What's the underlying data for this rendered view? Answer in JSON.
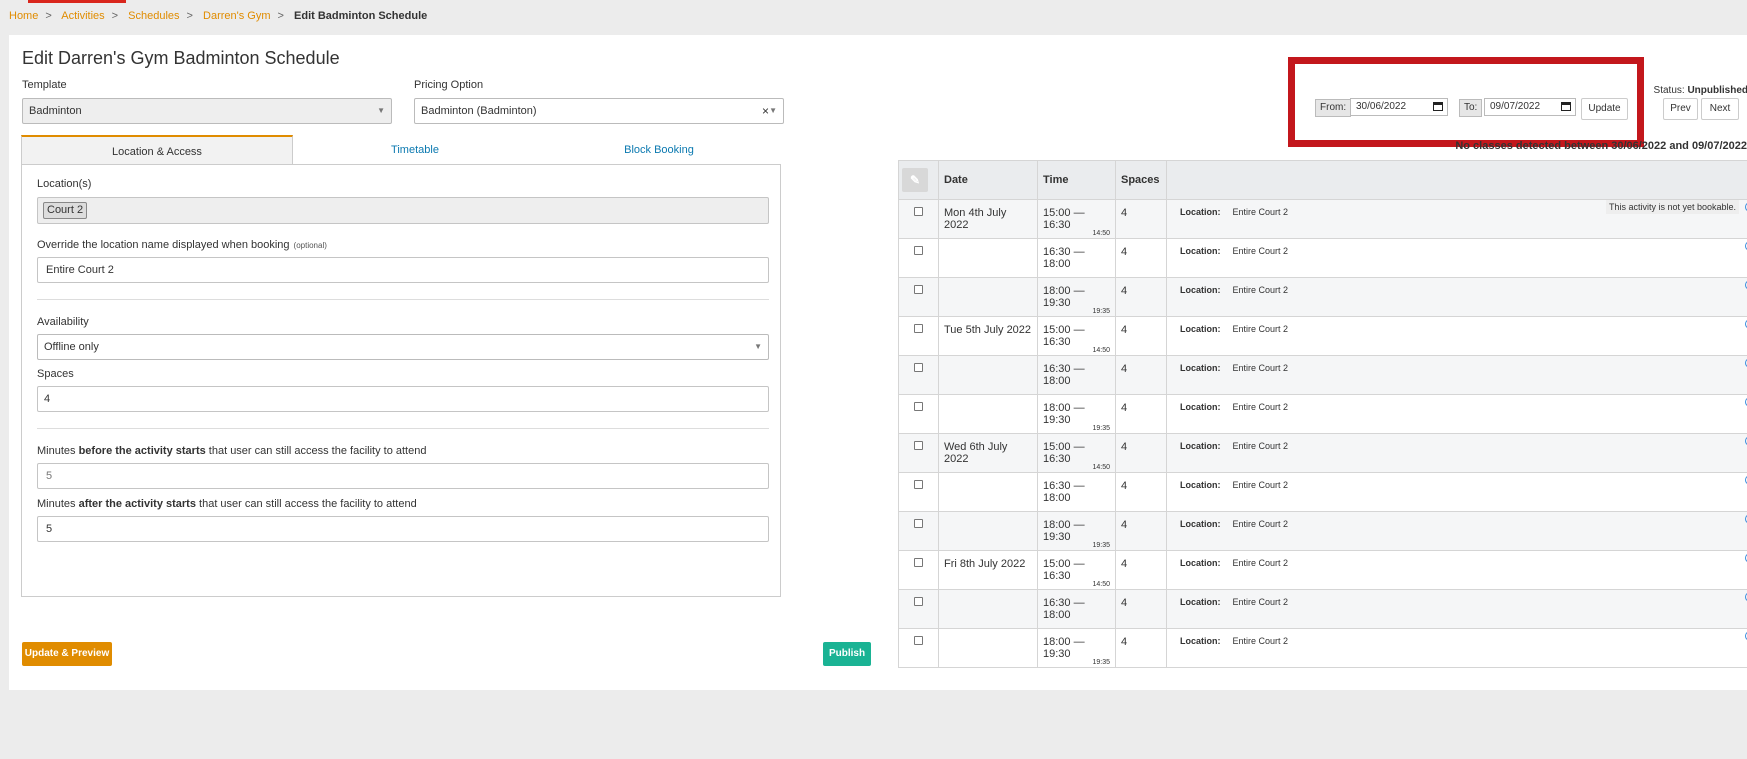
{
  "breadcrumb": [
    "Home",
    "Activities",
    "Schedules",
    "Darren's Gym"
  ],
  "breadcrumb_current": "Edit Badminton Schedule",
  "page_title": "Edit Darren's Gym Badminton Schedule",
  "template": {
    "label": "Template",
    "value": "Badminton"
  },
  "pricing": {
    "label": "Pricing Option",
    "value": "Badminton (Badminton)",
    "clear": "×"
  },
  "tabs": [
    "Location & Access",
    "Timetable",
    "Block Booking"
  ],
  "form": {
    "locations_label": "Location(s)",
    "location_chip": "Court 2",
    "override_label": "Override the location name displayed when booking",
    "override_optional": "(optional)",
    "override_value": "Entire Court 2",
    "availability_label": "Availability",
    "availability_value": "Offline only",
    "spaces_label": "Spaces",
    "spaces_value": "4",
    "before_pre": "Minutes ",
    "before_bold": "before the activity starts",
    "before_post": " that user can still access the facility to attend",
    "before_value": "5",
    "after_pre": "Minutes ",
    "after_bold": "after the activity starts",
    "after_post": " that user can still access the facility to attend",
    "after_value": "5"
  },
  "buttons": {
    "update_preview": "Update & Preview",
    "publish": "Publish",
    "update": "Update",
    "prev": "Prev",
    "next": "Next"
  },
  "colors": {
    "accent_orange": "#e08c00",
    "publish_green": "#1ab394",
    "highlight_red": "#c3171c"
  },
  "dates": {
    "from_label": "From:",
    "from_value": "30/06/2022",
    "to_label": "To:",
    "to_value": "09/07/2022"
  },
  "status_label": "Status: ",
  "status_value": "Unpublished",
  "notice": "No classes detected between 30/06/2022 and 09/07/2022",
  "table": {
    "headers": [
      "Date",
      "Time",
      "Spaces"
    ],
    "location_label": "Location:",
    "not_bookable": "This activity is not yet bookable.",
    "rows": [
      {
        "date": "Mon 4th July 2022",
        "time": "15:00 — 16:30",
        "sub": "14:50",
        "spaces": "4",
        "location": "Entire Court 2"
      },
      {
        "date": "",
        "time": "16:30 — 18:00",
        "sub": "",
        "spaces": "4",
        "location": "Entire Court 2"
      },
      {
        "date": "",
        "time": "18:00 — 19:30",
        "sub": "19:35",
        "spaces": "4",
        "location": "Entire Court 2"
      },
      {
        "date": "Tue 5th July 2022",
        "time": "15:00 — 16:30",
        "sub": "14:50",
        "spaces": "4",
        "location": "Entire Court 2"
      },
      {
        "date": "",
        "time": "16:30 — 18:00",
        "sub": "",
        "spaces": "4",
        "location": "Entire Court 2"
      },
      {
        "date": "",
        "time": "18:00 — 19:30",
        "sub": "19:35",
        "spaces": "4",
        "location": "Entire Court 2"
      },
      {
        "date": "Wed 6th July 2022",
        "time": "15:00 — 16:30",
        "sub": "14:50",
        "spaces": "4",
        "location": "Entire Court 2"
      },
      {
        "date": "",
        "time": "16:30 — 18:00",
        "sub": "",
        "spaces": "4",
        "location": "Entire Court 2"
      },
      {
        "date": "",
        "time": "18:00 — 19:30",
        "sub": "19:35",
        "spaces": "4",
        "location": "Entire Court 2"
      },
      {
        "date": "Fri 8th July 2022",
        "time": "15:00 — 16:30",
        "sub": "14:50",
        "spaces": "4",
        "location": "Entire Court 2"
      },
      {
        "date": "",
        "time": "16:30 — 18:00",
        "sub": "",
        "spaces": "4",
        "location": "Entire Court 2"
      },
      {
        "date": "",
        "time": "18:00 — 19:30",
        "sub": "19:35",
        "spaces": "4",
        "location": "Entire Court 2"
      }
    ]
  }
}
